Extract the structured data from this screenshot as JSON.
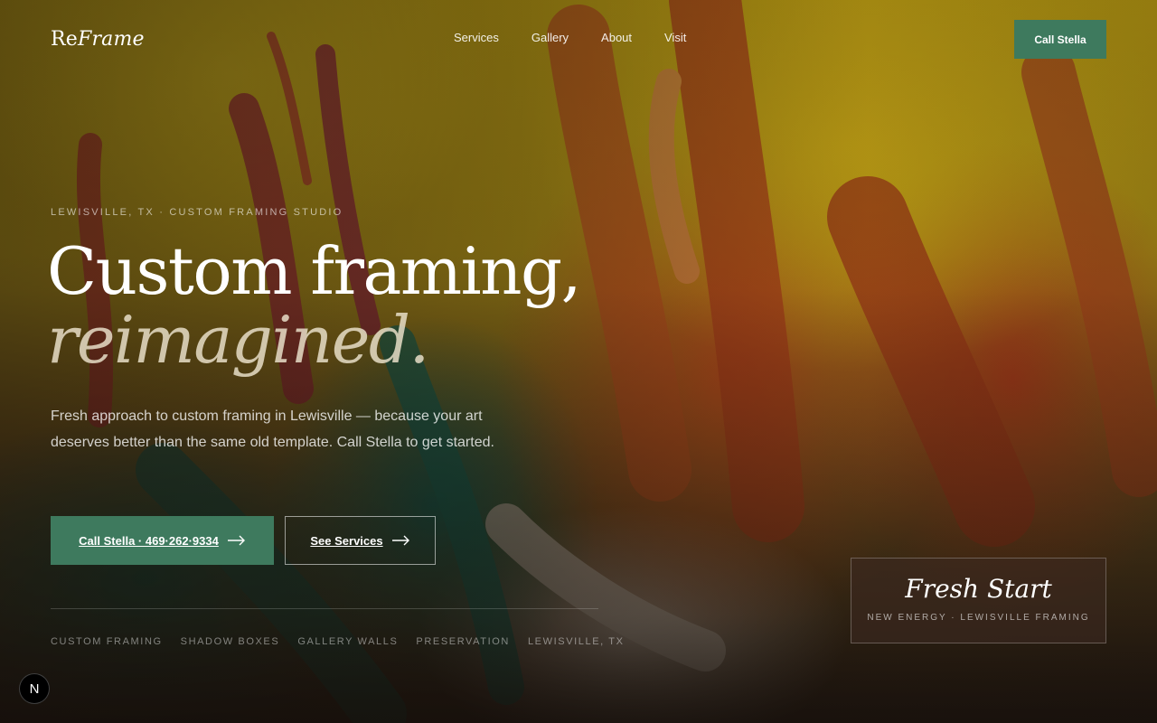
{
  "brand": {
    "logo_prefix": "Re",
    "logo_suffix": "Frame"
  },
  "nav": {
    "links": [
      "Services",
      "Gallery",
      "About",
      "Visit"
    ],
    "cta": "Call Stella"
  },
  "hero": {
    "eyebrow": "LEWISVILLE, TX · CUSTOM FRAMING STUDIO",
    "headline_line1": "Custom framing,",
    "headline_line2": "reimagined.",
    "lede": "Fresh approach to custom framing in Lewisville — because your art deserves better than the same old template. Call Stella to get started.",
    "primary_button": "Call Stella · 469·262·9334",
    "secondary_button": "See Services",
    "tags": [
      "CUSTOM FRAMING",
      "SHADOW BOXES",
      "GALLERY WALLS",
      "PRESERVATION",
      "LEWISVILLE, TX"
    ]
  },
  "card": {
    "title": "Fresh Start",
    "subtitle": "NEW ENERGY · LEWISVILLE FRAMING"
  },
  "dev_badge": {
    "label": "N"
  },
  "colors": {
    "accent": "#3e7a5e",
    "background_primary": "#cfae12",
    "card_background": "#3c2820"
  },
  "icons": {
    "button_arrow": "arrow-right-icon",
    "dev_badge": "nextjs-logo-icon"
  }
}
